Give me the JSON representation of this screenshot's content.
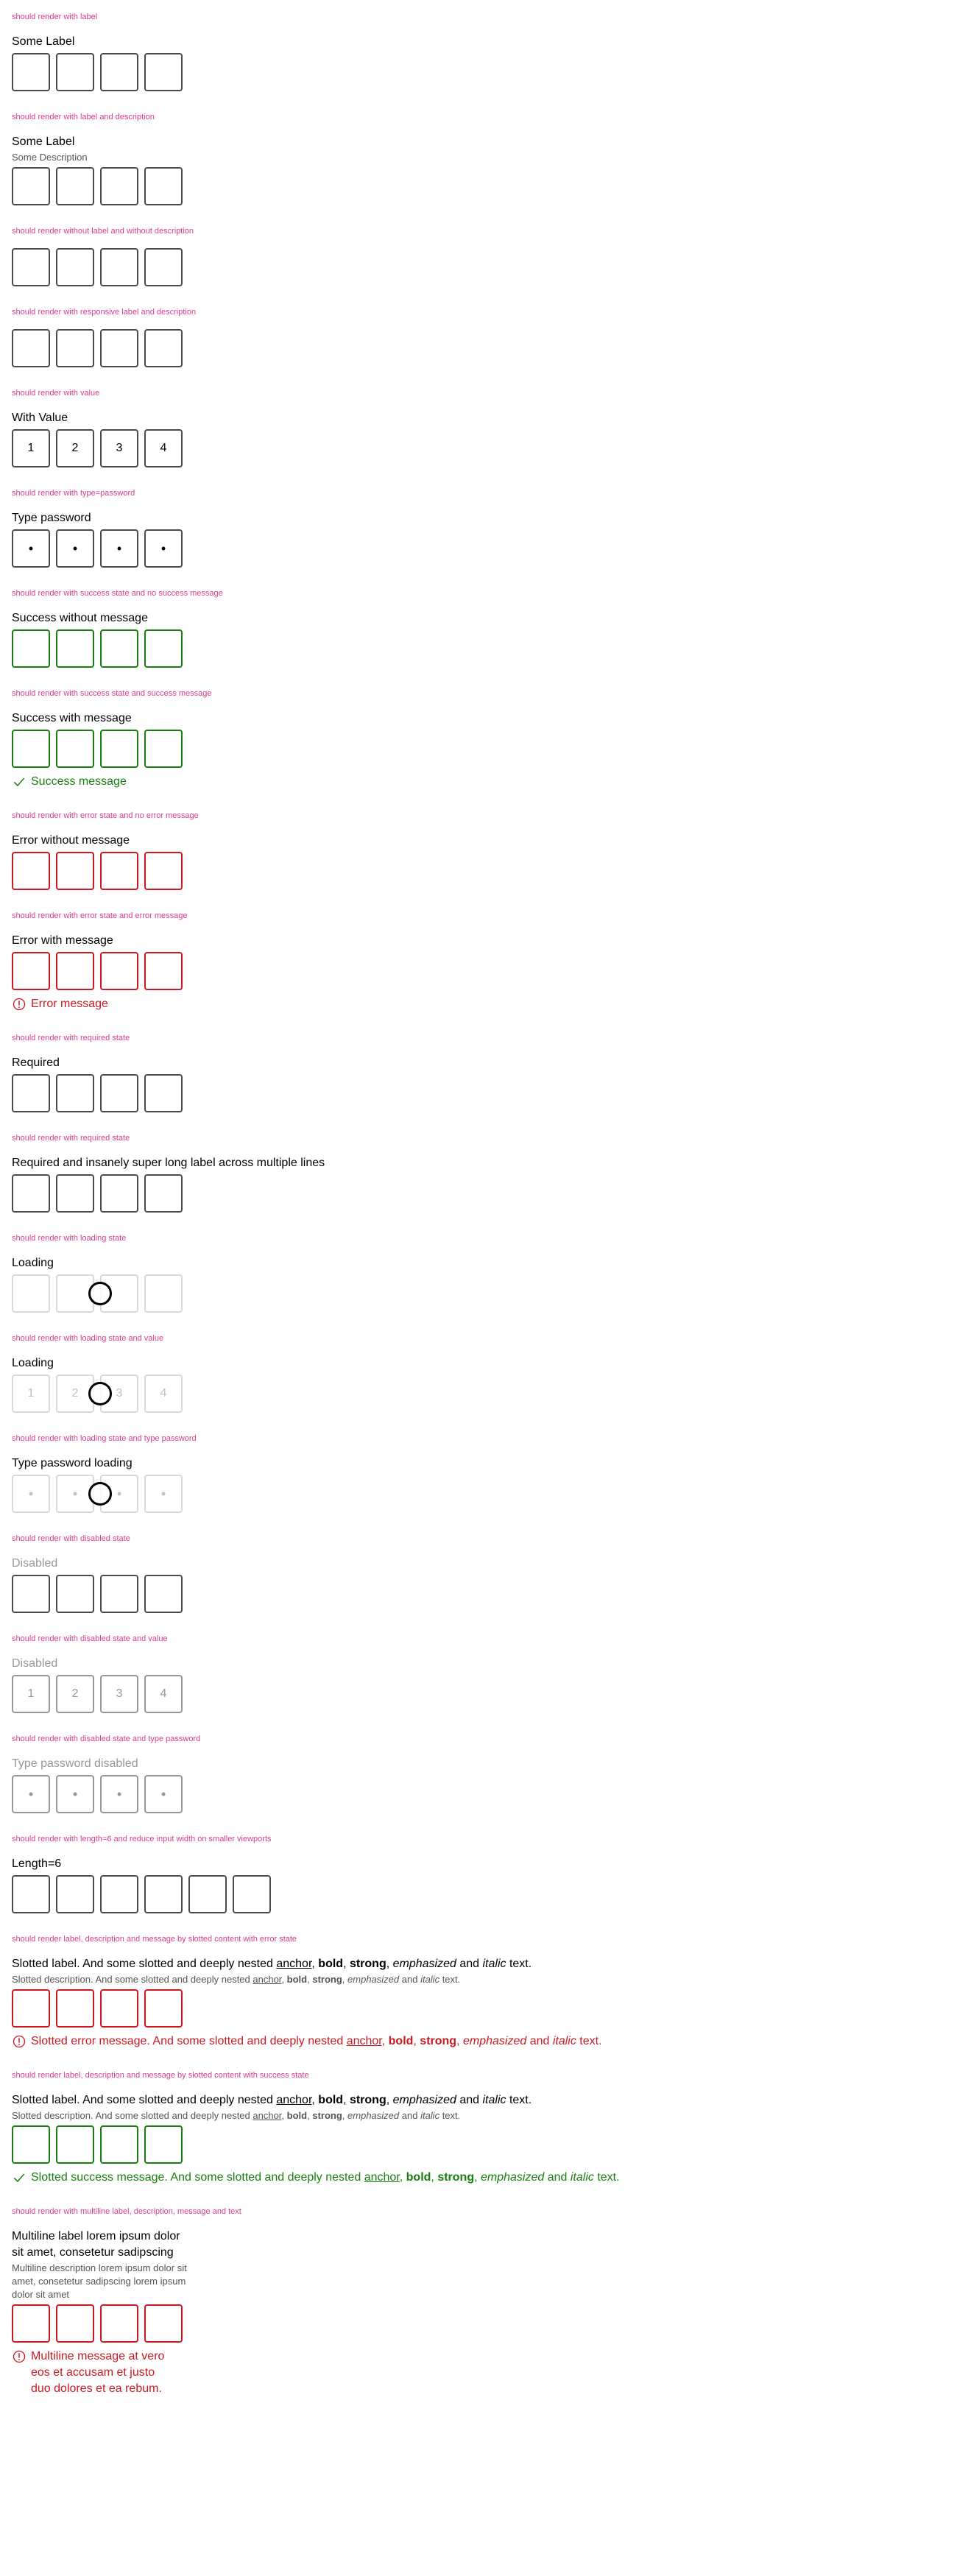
{
  "stories": {
    "s1": {
      "title": "should render with label",
      "label": "Some Label"
    },
    "s2": {
      "title": "should render with label and description",
      "label": "Some Label",
      "description": "Some Description"
    },
    "s3": {
      "title": "should render without label and without description"
    },
    "s4": {
      "title": "should render with responsive label and description"
    },
    "s5": {
      "title": "should render with value",
      "label": "With Value",
      "values": [
        "1",
        "2",
        "3",
        "4"
      ]
    },
    "s6": {
      "title": "should render with type=password",
      "label": "Type password",
      "values": [
        "•",
        "•",
        "•",
        "•"
      ]
    },
    "s7": {
      "title": "should render with success state and no success message",
      "label": "Success without message"
    },
    "s8": {
      "title": "should render with success state and success message",
      "label": "Success with message",
      "message": "Success message"
    },
    "s9": {
      "title": "should render with error state and no error message",
      "label": "Error without message"
    },
    "s10": {
      "title": "should render with error state and error message",
      "label": "Error with message",
      "message": "Error message"
    },
    "s11": {
      "title": "should render with required state",
      "label": "Required"
    },
    "s12": {
      "title": "should render with required state",
      "label": "Required and insanely super long label across multiple lines"
    },
    "s13": {
      "title": "should render with loading state",
      "label": "Loading"
    },
    "s14": {
      "title": "should render with loading state and value",
      "label": "Loading",
      "values": [
        "1",
        "2",
        "3",
        "4"
      ]
    },
    "s15": {
      "title": "should render with loading state and type password",
      "label": "Type password loading",
      "values": [
        "•",
        "•",
        "•",
        "•"
      ]
    },
    "s16": {
      "title": "should render with disabled state",
      "label": "Disabled"
    },
    "s17": {
      "title": "should render with disabled state and value",
      "label": "Disabled",
      "values": [
        "1",
        "2",
        "3",
        "4"
      ]
    },
    "s18": {
      "title": "should render with disabled state and type password",
      "label": "Type password disabled",
      "values": [
        "•",
        "•",
        "•",
        "•"
      ]
    },
    "s19": {
      "title": "should render with length=6 and reduce input width on smaller viewports",
      "label": "Length=6"
    },
    "s20": {
      "title": "should render label, description and message by slotted content with error state",
      "label": {
        "pre": "Slotted label. And some slotted and deeply nested ",
        "anchor": "anchor",
        "sep1": ", ",
        "bold": "bold",
        "sep2": ", ",
        "strong": "strong",
        "sep3": ", ",
        "em": "emphasized",
        "and": " and ",
        "italic": "italic",
        "post": " text."
      },
      "description": {
        "pre": "Slotted description. And some slotted and deeply nested ",
        "anchor": "anchor",
        "sep1": ", ",
        "bold": "bold",
        "sep2": ", ",
        "strong": "strong",
        "sep3": ", ",
        "em": "emphasized",
        "and": " and ",
        "italic": "italic",
        "post": " text."
      },
      "message": {
        "pre": "Slotted error message. And some slotted and deeply nested ",
        "anchor": "anchor",
        "sep1": ", ",
        "bold": "bold",
        "sep2": ", ",
        "strong": "strong",
        "sep3": ", ",
        "em": "emphasized",
        "and": " and ",
        "italic": "italic",
        "post": " text."
      }
    },
    "s21": {
      "title": "should render label, description and message by slotted content with success state",
      "label": {
        "pre": "Slotted label. And some slotted and deeply nested ",
        "anchor": "anchor",
        "sep1": ", ",
        "bold": "bold",
        "sep2": ", ",
        "strong": "strong",
        "sep3": ", ",
        "em": "emphasized",
        "and": " and ",
        "italic": "italic",
        "post": " text."
      },
      "description": {
        "pre": "Slotted description. And some slotted and deeply nested ",
        "anchor": "anchor",
        "sep1": ", ",
        "bold": "bold",
        "sep2": ", ",
        "strong": "strong",
        "sep3": ", ",
        "em": "emphasized",
        "and": " and ",
        "italic": "italic",
        "post": " text."
      },
      "message": {
        "pre": "Slotted success message. And some slotted and deeply nested ",
        "anchor": "anchor",
        "sep1": ", ",
        "bold": "bold",
        "sep2": ", ",
        "strong": "strong",
        "sep3": ", ",
        "em": "emphasized",
        "and": " and ",
        "italic": "italic",
        "post": " text."
      }
    },
    "s22": {
      "title": "should render with multiline label, description, message and text",
      "label": "Multiline label lorem ipsum dolor sit amet, consetetur sadipscing",
      "description": "Multiline description lorem ipsum dolor sit amet, consetetur sadipscing lorem ipsum dolor sit amet",
      "message": "Multiline message at vero eos et accusam et justo duo dolores et ea rebum."
    }
  },
  "colors": {
    "story_title": "#de3c8a",
    "border_default": "#4a4b4f",
    "success": "#197e10",
    "error": "#cc1922",
    "disabled": "#969799",
    "loading_border": "#d8d8db"
  },
  "icons": {
    "success": "check-icon",
    "error": "exclamation-icon",
    "loading": "spinner-icon"
  }
}
